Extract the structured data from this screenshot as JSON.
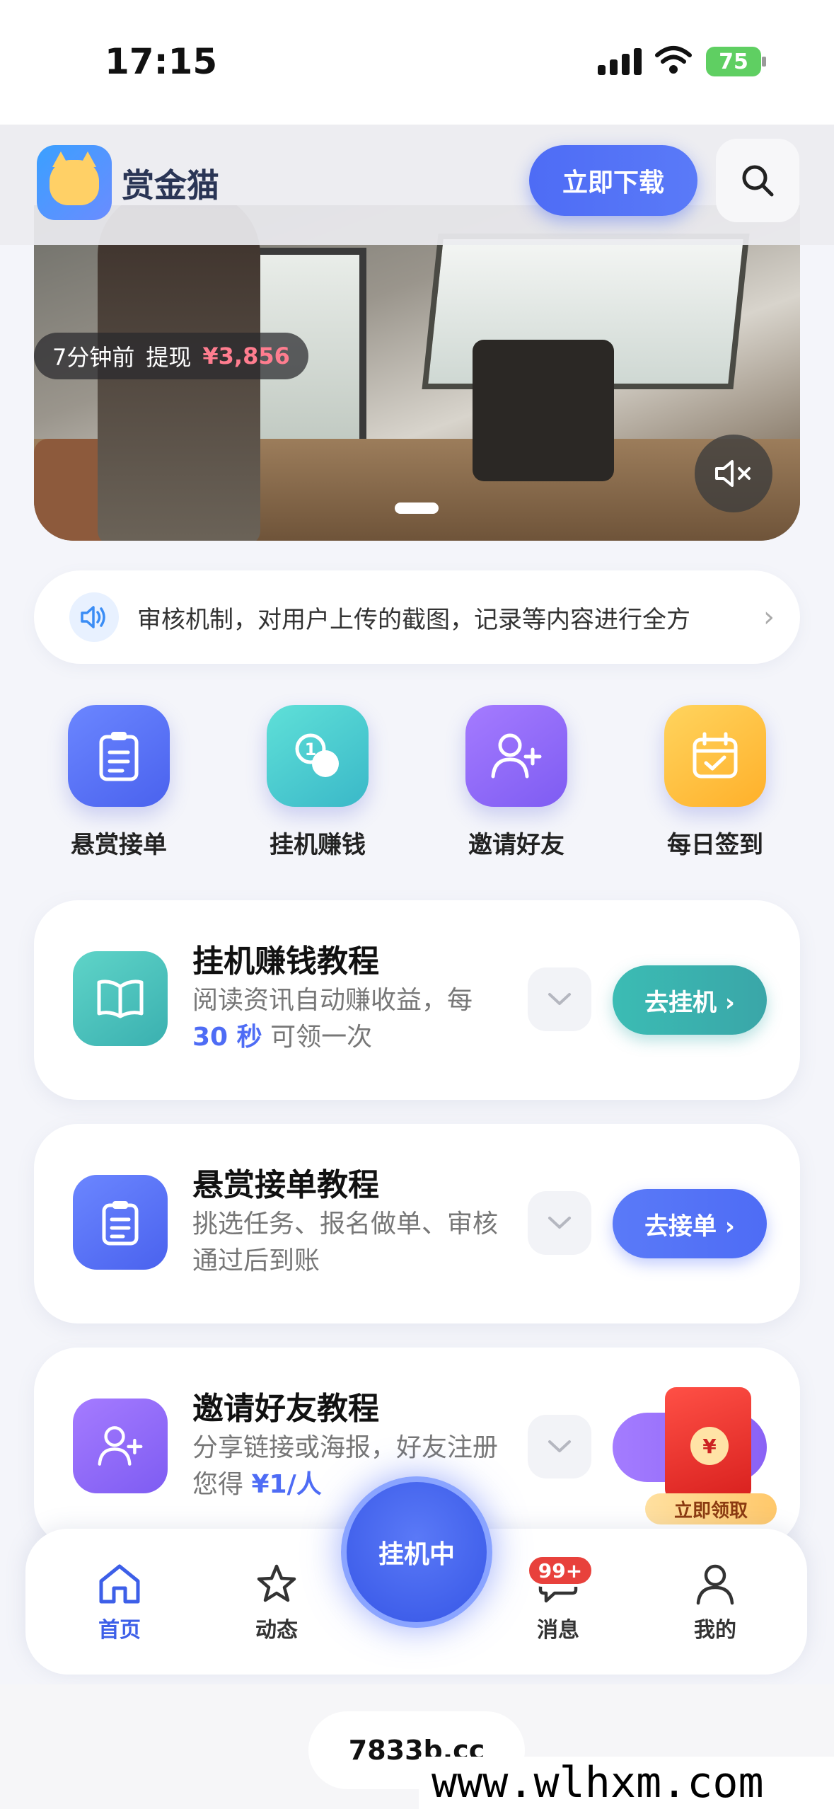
{
  "status_bar": {
    "time": "17:15",
    "battery": "75"
  },
  "header": {
    "app_name": "赏金猫",
    "download_label": "立即下载"
  },
  "hero": {
    "ticker_time": "7分钟前",
    "ticker_action": "提现",
    "ticker_amount": "¥3,856"
  },
  "notice": {
    "text": "审核机制，对用户上传的截图，记录等内容进行全方"
  },
  "quick_actions": [
    {
      "label": "悬赏接单",
      "icon": "clipboard-icon"
    },
    {
      "label": "挂机赚钱",
      "icon": "coins-icon"
    },
    {
      "label": "邀请好友",
      "icon": "add-user-icon"
    },
    {
      "label": "每日签到",
      "icon": "calendar-check-icon"
    }
  ],
  "cards": [
    {
      "title": "挂机赚钱教程",
      "desc_a": "阅读资讯自动赚收益，每",
      "highlight": "30 秒",
      "desc_b": "可领一次",
      "button": "去挂机 ›",
      "icon": "book-icon",
      "highlight_color": "#4e6cf5"
    },
    {
      "title": "悬赏接单教程",
      "desc_a": "挑选任务、报名做单、审核通过后到账",
      "button": "去接单 ›",
      "icon": "clipboard-icon"
    },
    {
      "title": "邀请好友教程",
      "desc_a": "分享链接或海报，好友注册您得",
      "highlight": "¥1/人",
      "button": "去",
      "icon": "add-user-icon",
      "highlight_color": "#4e6cf5"
    }
  ],
  "red_packet": {
    "seal": "¥",
    "label": "立即领取"
  },
  "tabbar": {
    "home": "首页",
    "feed": "动态",
    "center": "挂机中",
    "messages": "消息",
    "messages_badge": "99+",
    "mine": "我的"
  },
  "footer": {
    "domain": "7833b.cc",
    "watermark": "www.wlhxm.com"
  },
  "colors": {
    "accent": "#4e6cf5",
    "teal": "#3bbcb4",
    "price_red": "#ff7d8f",
    "badge_red": "#e8413c"
  }
}
